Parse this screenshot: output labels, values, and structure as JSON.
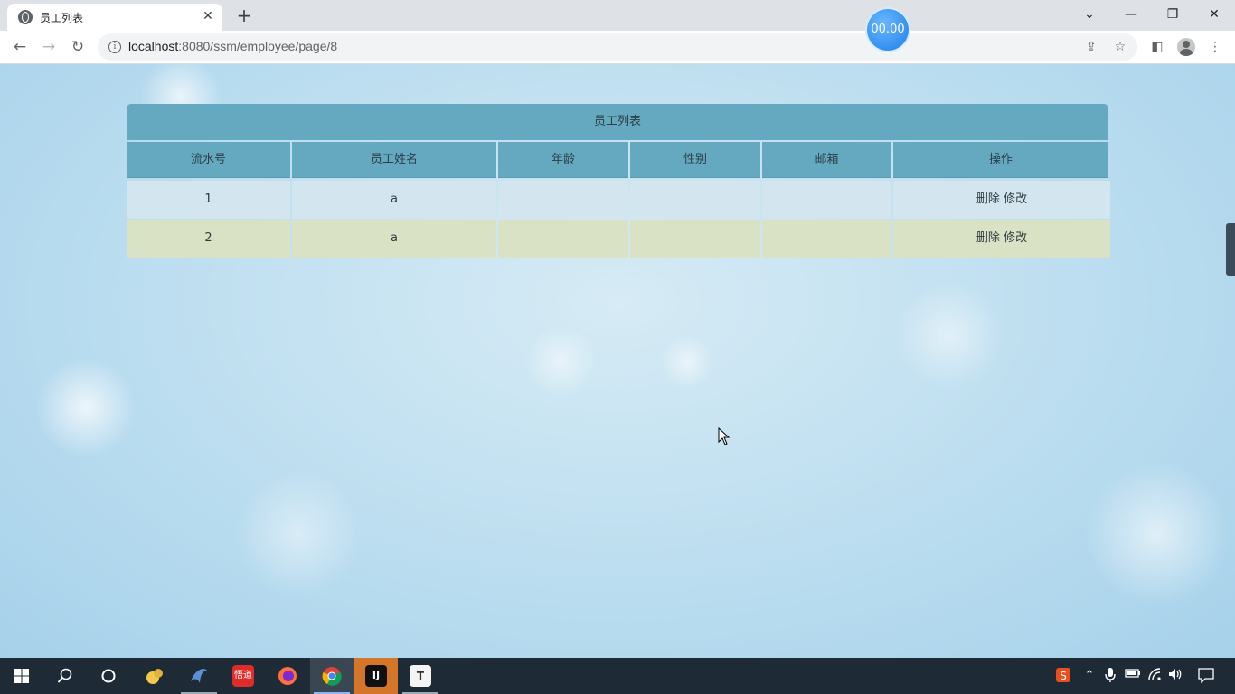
{
  "browser": {
    "tab_title": "员工列表",
    "tab_close": "✕",
    "new_tab": "+",
    "url_host": "localhost",
    "url_rest": ":8080/ssm/employee/page/8",
    "recorder_time": "00.00"
  },
  "table": {
    "caption": "员工列表",
    "columns": [
      "流水号",
      "员工姓名",
      "年龄",
      "性别",
      "邮箱",
      "操作"
    ],
    "rows": [
      {
        "id": "1",
        "name": "a",
        "age": "",
        "gender": "",
        "email": "",
        "delete": "删除",
        "edit": "修改"
      },
      {
        "id": "2",
        "name": "a",
        "age": "",
        "gender": "",
        "email": "",
        "delete": "删除",
        "edit": "修改"
      }
    ]
  },
  "colors": {
    "header_bg": "#64a9c0",
    "row_odd_bg": "#d3e6ef",
    "row_even_bg": "#d9e2c4",
    "taskbar_bg": "#1e2a36"
  },
  "taskbar": {
    "apps": [
      "windows-start-icon",
      "search-icon",
      "cortana-icon",
      "fruit-app-icon",
      "dolphin-app-icon",
      "red-app-icon",
      "firefox-icon",
      "chrome-icon",
      "intellij-icon",
      "typora-icon"
    ],
    "red_app_label": "悟道",
    "intellij_label": "IJ",
    "typora_label": "T"
  }
}
